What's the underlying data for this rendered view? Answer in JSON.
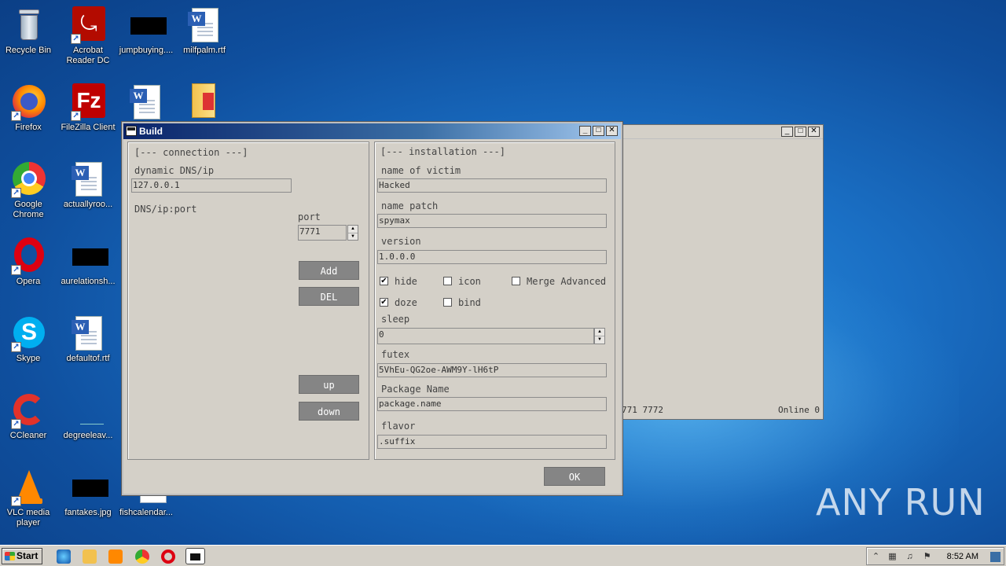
{
  "desktop_icons": [
    {
      "label": "Recycle Bin"
    },
    {
      "label": "Acrobat Reader DC"
    },
    {
      "label": "jumpbuying...."
    },
    {
      "label": "milfpalm.rtf"
    },
    {
      "label": "Firefox"
    },
    {
      "label": "FileZilla Client"
    },
    {
      "label": "Google Chrome"
    },
    {
      "label": "actuallyroo..."
    },
    {
      "label": "Opera"
    },
    {
      "label": "aurelationsh..."
    },
    {
      "label": "Skype"
    },
    {
      "label": "defaultof.rtf"
    },
    {
      "label": "CCleaner"
    },
    {
      "label": "degreeleav..."
    },
    {
      "label": "VLC media player"
    },
    {
      "label": "fantakes.jpg"
    },
    {
      "label": "fishcalendar..."
    }
  ],
  "back_window": {
    "status_ports": "771 7772",
    "status_online": "Online 0"
  },
  "build": {
    "title": "Build",
    "connection": {
      "header": "[--- connection ---]",
      "dns_label": "dynamic DNS/ip",
      "dns_value": "127.0.0.1",
      "list_label": "DNS/ip:port",
      "port_label": "port",
      "port_value": "7771",
      "add": "Add",
      "del": "DEL",
      "up": "up",
      "down": "down"
    },
    "installation": {
      "header": "[--- installation ---]",
      "victim_label": "name of victim",
      "victim_value": "Hacked",
      "patch_label": "name patch",
      "patch_value": "spymax",
      "version_label": "version",
      "version_value": "1.0.0.0",
      "hide": "hide",
      "icon": "icon",
      "merge": "Merge Advanced",
      "doze": "doze",
      "bind": "bind",
      "sleep_label": "sleep",
      "sleep_value": "0",
      "futex_label": "futex",
      "futex_value": "5VhEu-QG2oe-AWM9Y-lH6tP",
      "package_label": "Package Name",
      "package_value": "package.name",
      "flavor_label": "flavor",
      "flavor_value": ".suffix"
    },
    "checkboxes": {
      "hide": true,
      "icon": false,
      "merge": false,
      "doze": true,
      "bind": false
    },
    "ok": "OK"
  },
  "taskbar": {
    "start": "Start",
    "clock": "8:52 AM"
  },
  "watermark": "ANY RUN"
}
